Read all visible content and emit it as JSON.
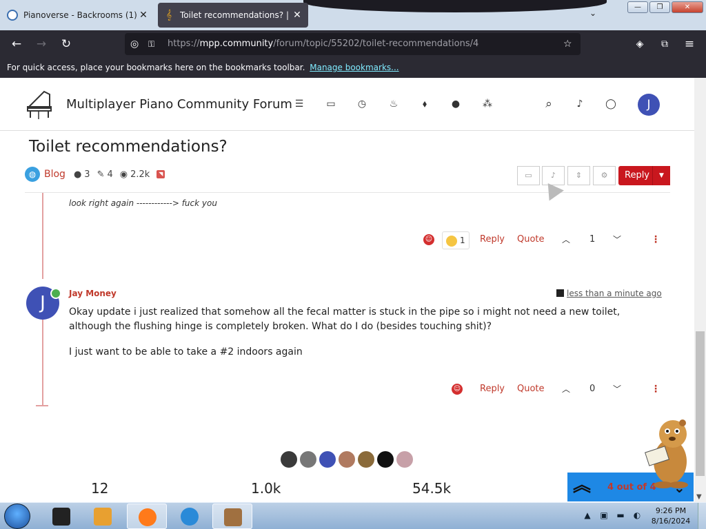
{
  "browser": {
    "tabs": [
      {
        "title": "Pianoverse - Backrooms (1)",
        "close": "✕"
      },
      {
        "title": "Toilet recommendations? | mpp",
        "close": "✕"
      }
    ],
    "tab_list_icon": "chevron-down-icon",
    "window_buttons": {
      "minimize": "—",
      "maximize": "❐",
      "close": "✕"
    },
    "nav": {
      "back": "←",
      "forward": "→",
      "reload": "↻"
    },
    "url": {
      "prefix": "https://",
      "domain": "mpp.community",
      "path": "/forum/topic/55202/toilet-recommendations/4"
    },
    "url_icons": {
      "shield": "◎",
      "lock": "🔒",
      "star": "☆"
    },
    "toolbar_icons": {
      "pocket": "◈",
      "extensions": "⧉",
      "menu": "≡"
    },
    "bookmarks_bar": {
      "text": "For quick access, place your bookmarks here on the bookmarks toolbar.",
      "link": "Manage bookmarks..."
    }
  },
  "site": {
    "title": "Multiplayer Piano Community Forum",
    "nav_icons": [
      "list-icon",
      "inbox-icon",
      "clock-icon",
      "fire-icon",
      "tags-icon",
      "user-icon",
      "users-icon"
    ],
    "nav_glyphs": [
      "☰",
      "▭",
      "◷",
      "♨",
      "⬧",
      "●",
      "⁂"
    ],
    "right_icons": {
      "search": "⌕",
      "bell": "♪",
      "chat": "◯"
    },
    "user_initial": "J"
  },
  "topic": {
    "title": "Toilet recommendations?",
    "category": "Blog",
    "posters": "3",
    "posts": "4",
    "views": "2.2k",
    "reply_label": "Reply",
    "reply_dropdown": "▼",
    "tool_icons": [
      "inbox-icon",
      "bell-icon",
      "sort-icon",
      "gear-icon"
    ],
    "tool_glyphs": [
      "▭",
      "♪",
      "⇕",
      "⚙"
    ]
  },
  "posts": [
    {
      "text": "look right again ------------> fuck you",
      "reaction": {
        "emoji": "😭",
        "count": "1"
      },
      "reply": "Reply",
      "quote": "Quote",
      "votes": "1"
    },
    {
      "author": "Jay Money",
      "avatar_initial": "J",
      "time": "less than a minute ago",
      "paragraphs": [
        "Okay update i just realized that somehow all the fecal matter is stuck in the pipe so i might not need a new toilet, although the flushing hinge is completely broken. What do I do (besides touching shit)?",
        "I just want to be able to take a #2 indoors again"
      ],
      "reply": "Reply",
      "quote": "Quote",
      "votes": "0"
    }
  ],
  "footer": {
    "stats": [
      "12",
      "1.0k",
      "54.5k"
    ],
    "user_avatar_colors": [
      "#3a3a3a",
      "#777777",
      "#3f51b5",
      "#b07a60",
      "#8a6a3a",
      "#111111",
      "#c7a0a8"
    ],
    "pager_text": "4 out of 4"
  },
  "taskbar": {
    "time": "9:26 PM",
    "date": "8/16/2024",
    "app_colors": [
      "#222222",
      "#e8a030",
      "#ff7a1a",
      "#2a8ad8",
      "#a07040"
    ]
  },
  "colors": {
    "accent": "#c0392b",
    "reply_button": "#c9171e",
    "avatar": "#3f51b5",
    "pager": "#1e88e5"
  }
}
